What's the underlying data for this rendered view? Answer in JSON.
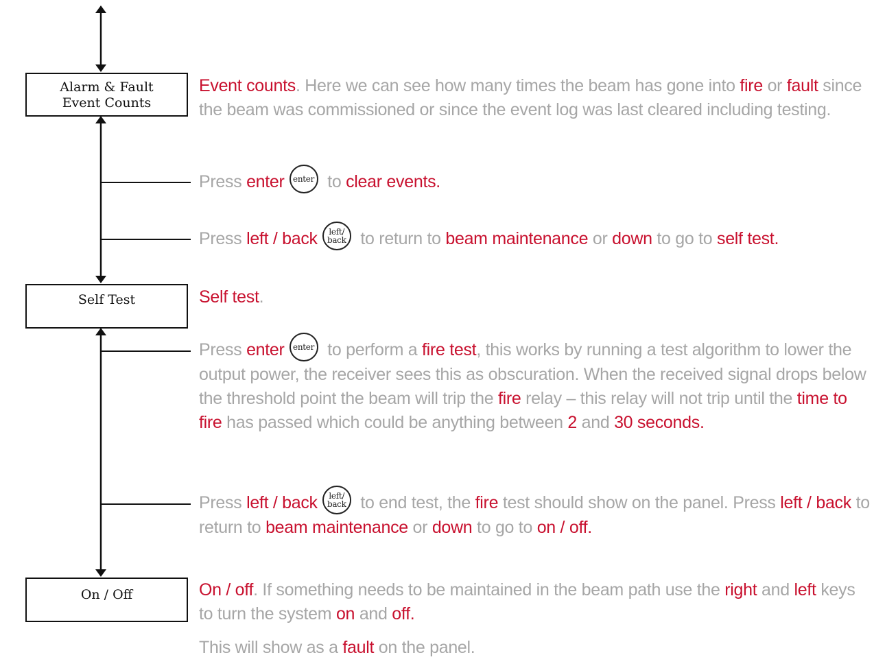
{
  "boxes": {
    "alarm_fault": {
      "line1": "Alarm & Fault",
      "line2": "Event Counts"
    },
    "self_test": {
      "label": "Self Test"
    },
    "on_off": {
      "label": "On / Off"
    }
  },
  "keys": {
    "enter": "enter",
    "left_back_1": "left/",
    "left_back_2": "back"
  },
  "text": {
    "event_counts": {
      "t1": "Event counts",
      "t2": ". Here we can see how many times the beam has gone into ",
      "t3": "fire",
      "t4": " or ",
      "t5": "fault",
      "t6": " since the beam was commissioned or since the event log was last cleared including testing."
    },
    "press_enter_clear": {
      "t1": "Press ",
      "t2": "enter",
      "t3": " to ",
      "t4": "clear events."
    },
    "press_back_1": {
      "t1": "Press ",
      "t2": "left / back",
      "t3": " to return to ",
      "t4": "beam maintenance",
      "t5": " or ",
      "t6": "down",
      "t7": " to go to ",
      "t8": "self test."
    },
    "self_test_title": {
      "t1": "Self test",
      "t2": "."
    },
    "press_enter_fire": {
      "t1": "Press ",
      "t2": "enter",
      "t3": " to perform a ",
      "t4": "fire test",
      "t5": ", this works by running a test algorithm to lower the output power, the receiver sees this as obscuration. When the received signal drops below the threshold point the beam will trip the ",
      "t6": "fire",
      "t7": " relay – this relay will not trip until the ",
      "t8": "time to fire",
      "t9": " has passed which could be anything between ",
      "t10": "2",
      "t11": " and ",
      "t12": "30 seconds."
    },
    "press_back_2": {
      "t1": "Press ",
      "t2": "left / back",
      "t3": " to end test, the ",
      "t4": "fire",
      "t5": " test should show on the panel. Press ",
      "t6": "left / back",
      "t7": " to return to ",
      "t8": "beam maintenance",
      "t9": " or ",
      "t10": "down",
      "t11": " to go to ",
      "t12": "on / off."
    },
    "on_off_desc": {
      "t1": "On / off",
      "t2": ". If something needs to be maintained in the beam path use the ",
      "t3": "right",
      "t4": " and ",
      "t5": "left",
      "t6": " keys to turn the system ",
      "t7": "on",
      "t8": " and ",
      "t9": "off."
    },
    "fault_note": {
      "t1": "This will show as a ",
      "t2": "fault",
      "t3": " on the panel."
    }
  }
}
